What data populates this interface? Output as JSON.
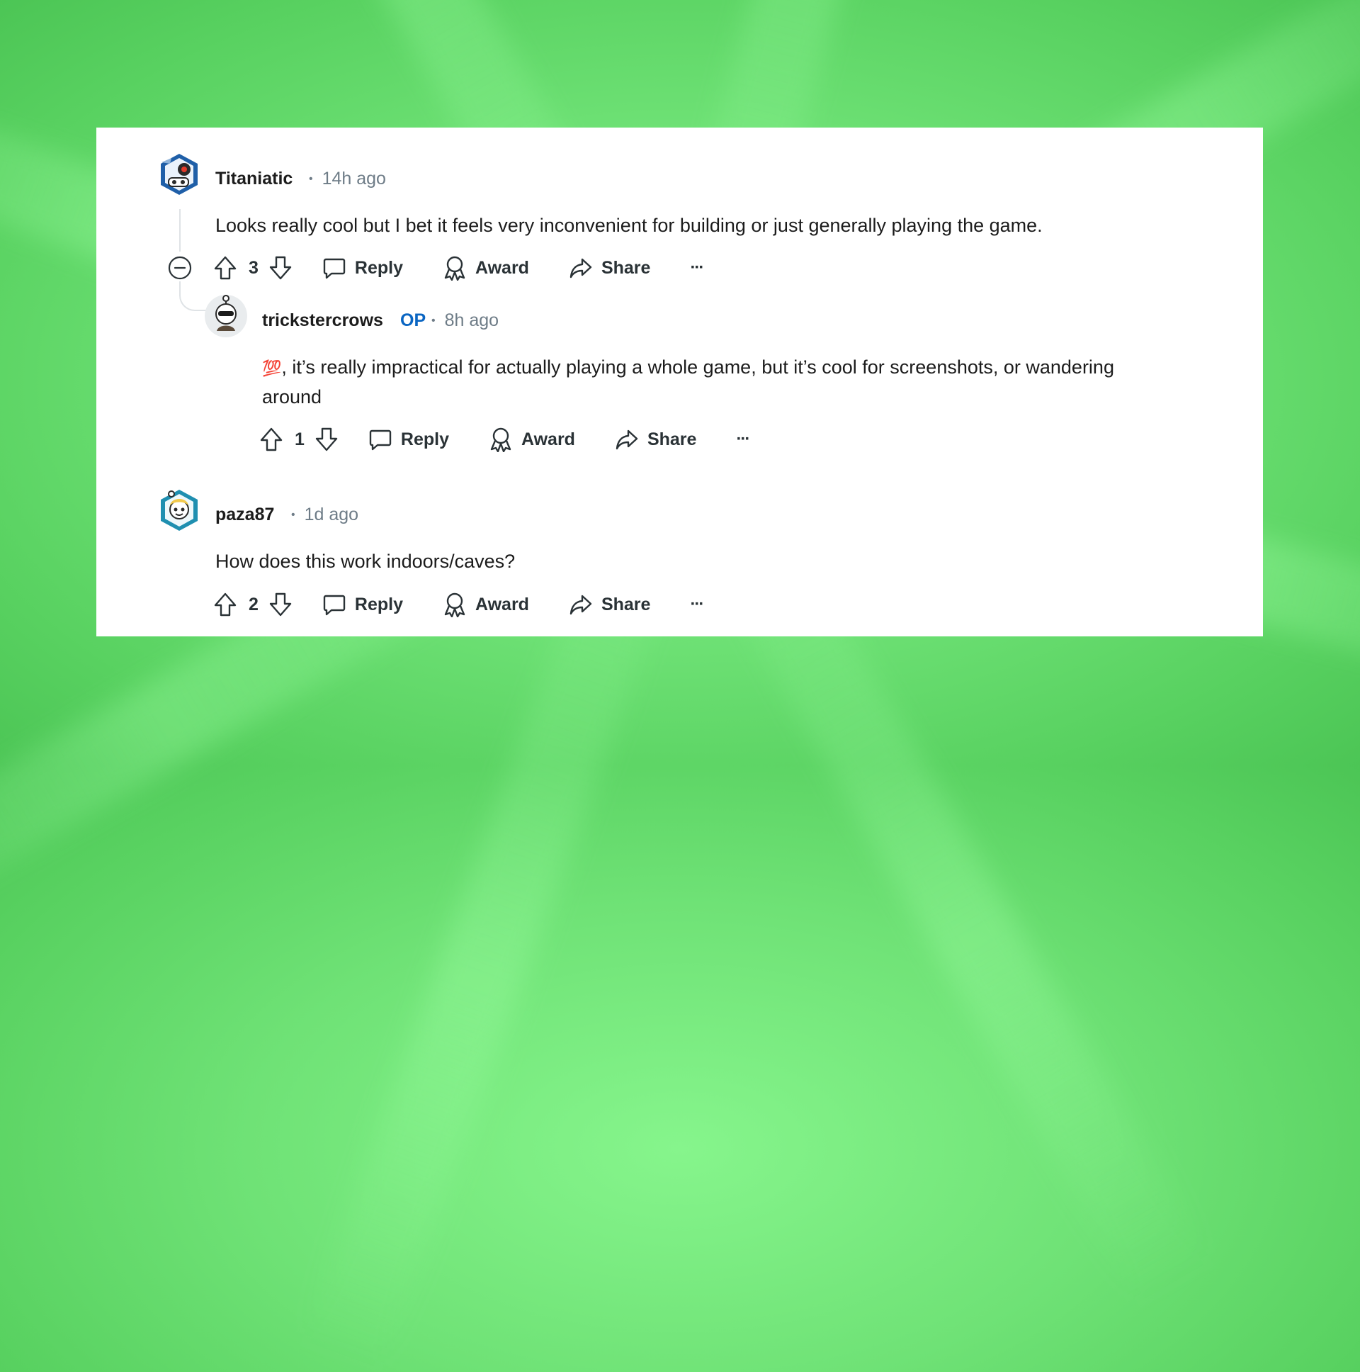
{
  "comments": [
    {
      "author": "Titaniatic",
      "time": "14h ago",
      "text": "Looks really cool but I bet it feels very inconvenient for building or just generally playing the game.",
      "votes": "3",
      "actions": {
        "reply": "Reply",
        "award": "Award",
        "share": "Share"
      }
    },
    {
      "author": "trickstercrows",
      "badge": "OP",
      "time": "8h ago",
      "emoji": "💯",
      "text_line1": ", it’s really impractical for actually playing a whole game, but it’s cool for screenshots, or wandering",
      "text_line2": "around",
      "votes": "1",
      "actions": {
        "reply": "Reply",
        "award": "Award",
        "share": "Share"
      }
    },
    {
      "author": "paza87",
      "time": "1d ago",
      "text": "How does this work indoors/caves?",
      "votes": "2",
      "actions": {
        "reply": "Reply",
        "award": "Award",
        "share": "Share"
      }
    }
  ],
  "separator": "•",
  "more_label": "···",
  "colors": {
    "op": "#0a65c2",
    "meta": "#6e7c87",
    "text": "#1c1c1c",
    "background": "#6fe276"
  }
}
